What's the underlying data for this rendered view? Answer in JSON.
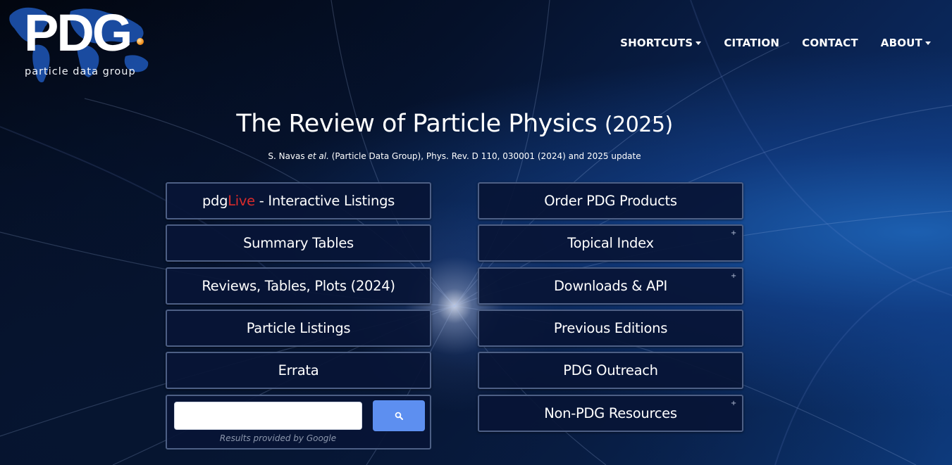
{
  "logo": {
    "main": "PDG",
    "sub": "particle data group"
  },
  "nav": {
    "shortcuts": "SHORTCUTS",
    "citation": "CITATION",
    "contact": "CONTACT",
    "about": "ABOUT"
  },
  "header": {
    "title": "The Review of Particle Physics",
    "year": "(2025)",
    "citation_authors": "S. Navas",
    "citation_etal": "et al.",
    "citation_rest": "(Particle Data Group), Phys. Rev. D 110, 030001 (2024) and 2025 update"
  },
  "left_buttons": {
    "pdglive_prefix": "pdg",
    "pdglive_live": "Live",
    "pdglive_suffix": " - Interactive Listings",
    "summary_tables": "Summary Tables",
    "reviews": "Reviews, Tables, Plots (2024)",
    "particle_listings": "Particle Listings",
    "errata": "Errata"
  },
  "right_buttons": {
    "order": "Order PDG Products",
    "topical_index": "Topical Index",
    "downloads": "Downloads & API",
    "previous_editions": "Previous Editions",
    "outreach": "PDG Outreach",
    "non_pdg": "Non-PDG Resources",
    "plus": "+"
  },
  "search": {
    "value": "",
    "placeholder": "",
    "note": "Results provided by Google"
  },
  "colors": {
    "live_red": "#d92b2b",
    "search_button": "#5d8ff0",
    "button_bg": "#081436",
    "button_border": "#4d5f85"
  },
  "icons": {
    "search": "search-icon",
    "caret": "caret-down-icon"
  }
}
